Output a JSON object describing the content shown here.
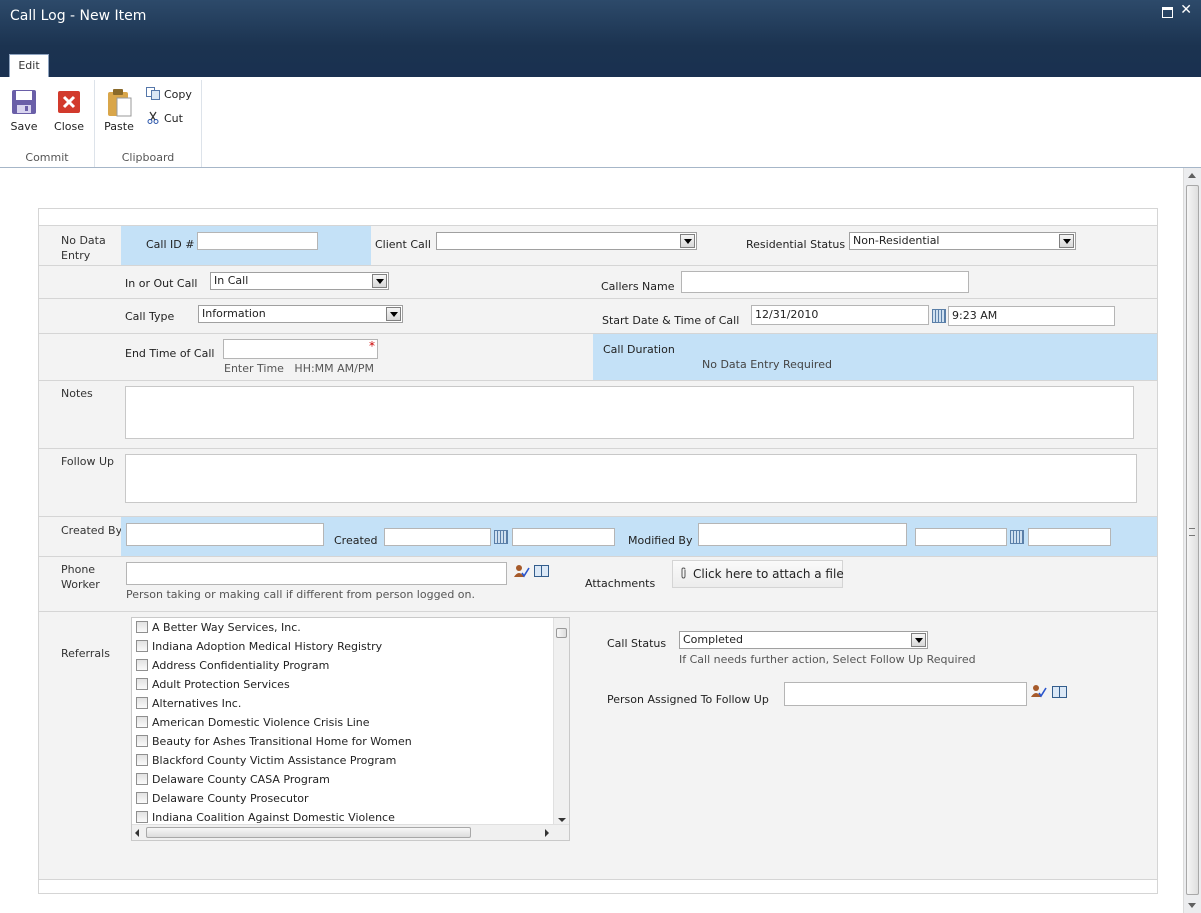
{
  "window": {
    "title": "Call Log - New Item"
  },
  "ribbon": {
    "tab": "Edit",
    "commit": {
      "label": "Commit",
      "save": "Save",
      "close": "Close"
    },
    "clipboard": {
      "label": "Clipboard",
      "paste": "Paste",
      "copy": "Copy",
      "cut": "Cut"
    }
  },
  "form": {
    "no_data_entry": "No Data Entry",
    "call_id_label": "Call ID #",
    "call_id_value": "",
    "client_call_label": "Client Call",
    "client_call_value": "",
    "residential_status_label": "Residential Status",
    "residential_status_value": "Non-Residential",
    "in_out_label": "In or Out Call",
    "in_out_value": "In Call",
    "callers_name_label": "Callers Name",
    "callers_name_value": "",
    "call_type_label": "Call Type",
    "call_type_value": "Information",
    "start_label": "Start Date & Time of Call",
    "start_date": "12/31/2010",
    "start_time": "9:23 AM",
    "end_time_label": "End Time of Call",
    "end_time_hint": "Enter Time   HH:MM AM/PM",
    "call_duration_label": "Call Duration",
    "call_duration_value": "No Data Entry Required",
    "notes_label": "Notes",
    "follow_up_label": "Follow Up",
    "created_by_label": "Created By",
    "created_label": "Created",
    "modified_by_label": "Modified By",
    "phone_worker_label": "Phone Worker",
    "phone_worker_hint": "Person taking or making call if different from person logged on.",
    "attachments_label": "Attachments",
    "attach_button": "Click here to attach a file",
    "referrals_label": "Referrals",
    "referrals": [
      "A Better Way Services, Inc.",
      "Indiana Adoption Medical History Registry",
      "Address Confidentiality Program",
      "Adult Protection Services",
      "Alternatives Inc.",
      "American Domestic Violence Crisis Line",
      "Beauty for Ashes Transitional Home for Women",
      "Blackford County Victim Assistance Program",
      "Delaware County CASA Program",
      "Delaware County Prosecutor",
      "Indiana Coalition Against Domestic Violence"
    ],
    "call_status_label": "Call Status",
    "call_status_value": "Completed",
    "call_status_hint": "If Call needs further action, Select Follow Up Required",
    "person_assigned_label": "Person Assigned To Follow Up"
  },
  "colors": {
    "title_bar": "#1b3350",
    "highlight": "#c4e1f7",
    "required": "#cc0000"
  },
  "icons": [
    "save-icon",
    "close-icon",
    "paste-icon",
    "copy-icon",
    "cut-icon",
    "calendar-icon",
    "check-names-icon",
    "address-book-icon",
    "paperclip-icon"
  ]
}
